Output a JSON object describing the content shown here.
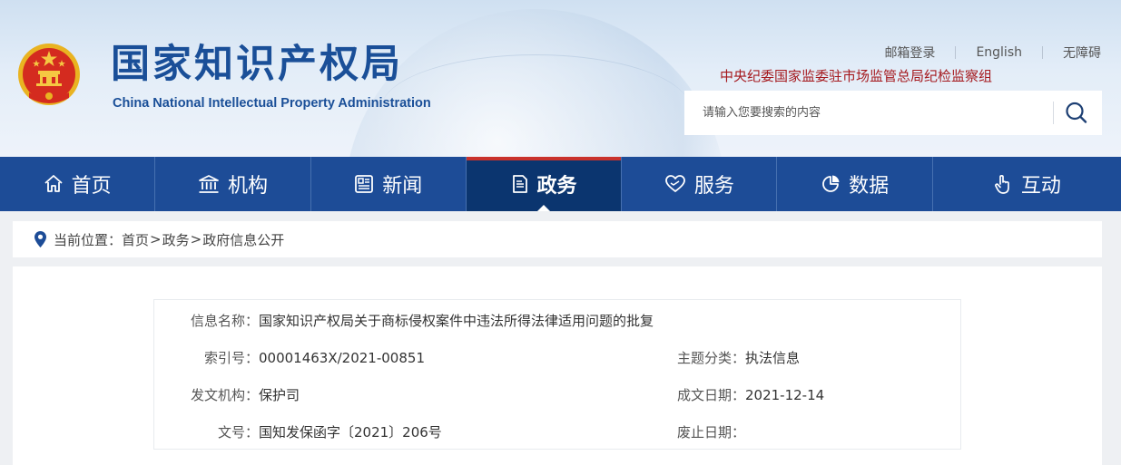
{
  "header": {
    "title_cn": "国家知识产权局",
    "title_en": "China National Intellectual Property Administration",
    "toplinks": [
      "邮箱登录",
      "English",
      "无障碍"
    ],
    "jiwei": "中央纪委国家监委驻市场监管总局纪检监察组",
    "search": {
      "placeholder": "请输入您要搜索的内容"
    }
  },
  "nav": [
    {
      "label": "首页",
      "icon": "home-icon"
    },
    {
      "label": "机构",
      "icon": "institution-icon"
    },
    {
      "label": "新闻",
      "icon": "news-icon"
    },
    {
      "label": "政务",
      "icon": "document-icon",
      "active": true
    },
    {
      "label": "服务",
      "icon": "heart-hand-icon"
    },
    {
      "label": "数据",
      "icon": "pie-chart-icon"
    },
    {
      "label": "互动",
      "icon": "pointer-hand-icon"
    }
  ],
  "breadcrumb": {
    "prefix": "当前位置：",
    "items": [
      "首页",
      "政务",
      "政府信息公开"
    ],
    "separator": ">"
  },
  "info": {
    "name": {
      "label": "信息名称：",
      "value": "国家知识产权局关于商标侵权案件中违法所得法律适用问题的批复"
    },
    "index": {
      "label": "索引号：",
      "value": "00001463X/2021-00851"
    },
    "category": {
      "label": "主题分类：",
      "value": "执法信息"
    },
    "issuer": {
      "label": "发文机构：",
      "value": "保护司"
    },
    "date": {
      "label": "成文日期：",
      "value": "2021-12-14"
    },
    "docno": {
      "label": "文号：",
      "value": "国知发保函字〔2021〕206号"
    },
    "abolish": {
      "label": "废止日期：",
      "value": ""
    }
  },
  "colors": {
    "nav": "#1d4c97",
    "nav_active": "#0b356f",
    "accent_red": "#c9322c",
    "title_blue": "#1a4f98"
  }
}
